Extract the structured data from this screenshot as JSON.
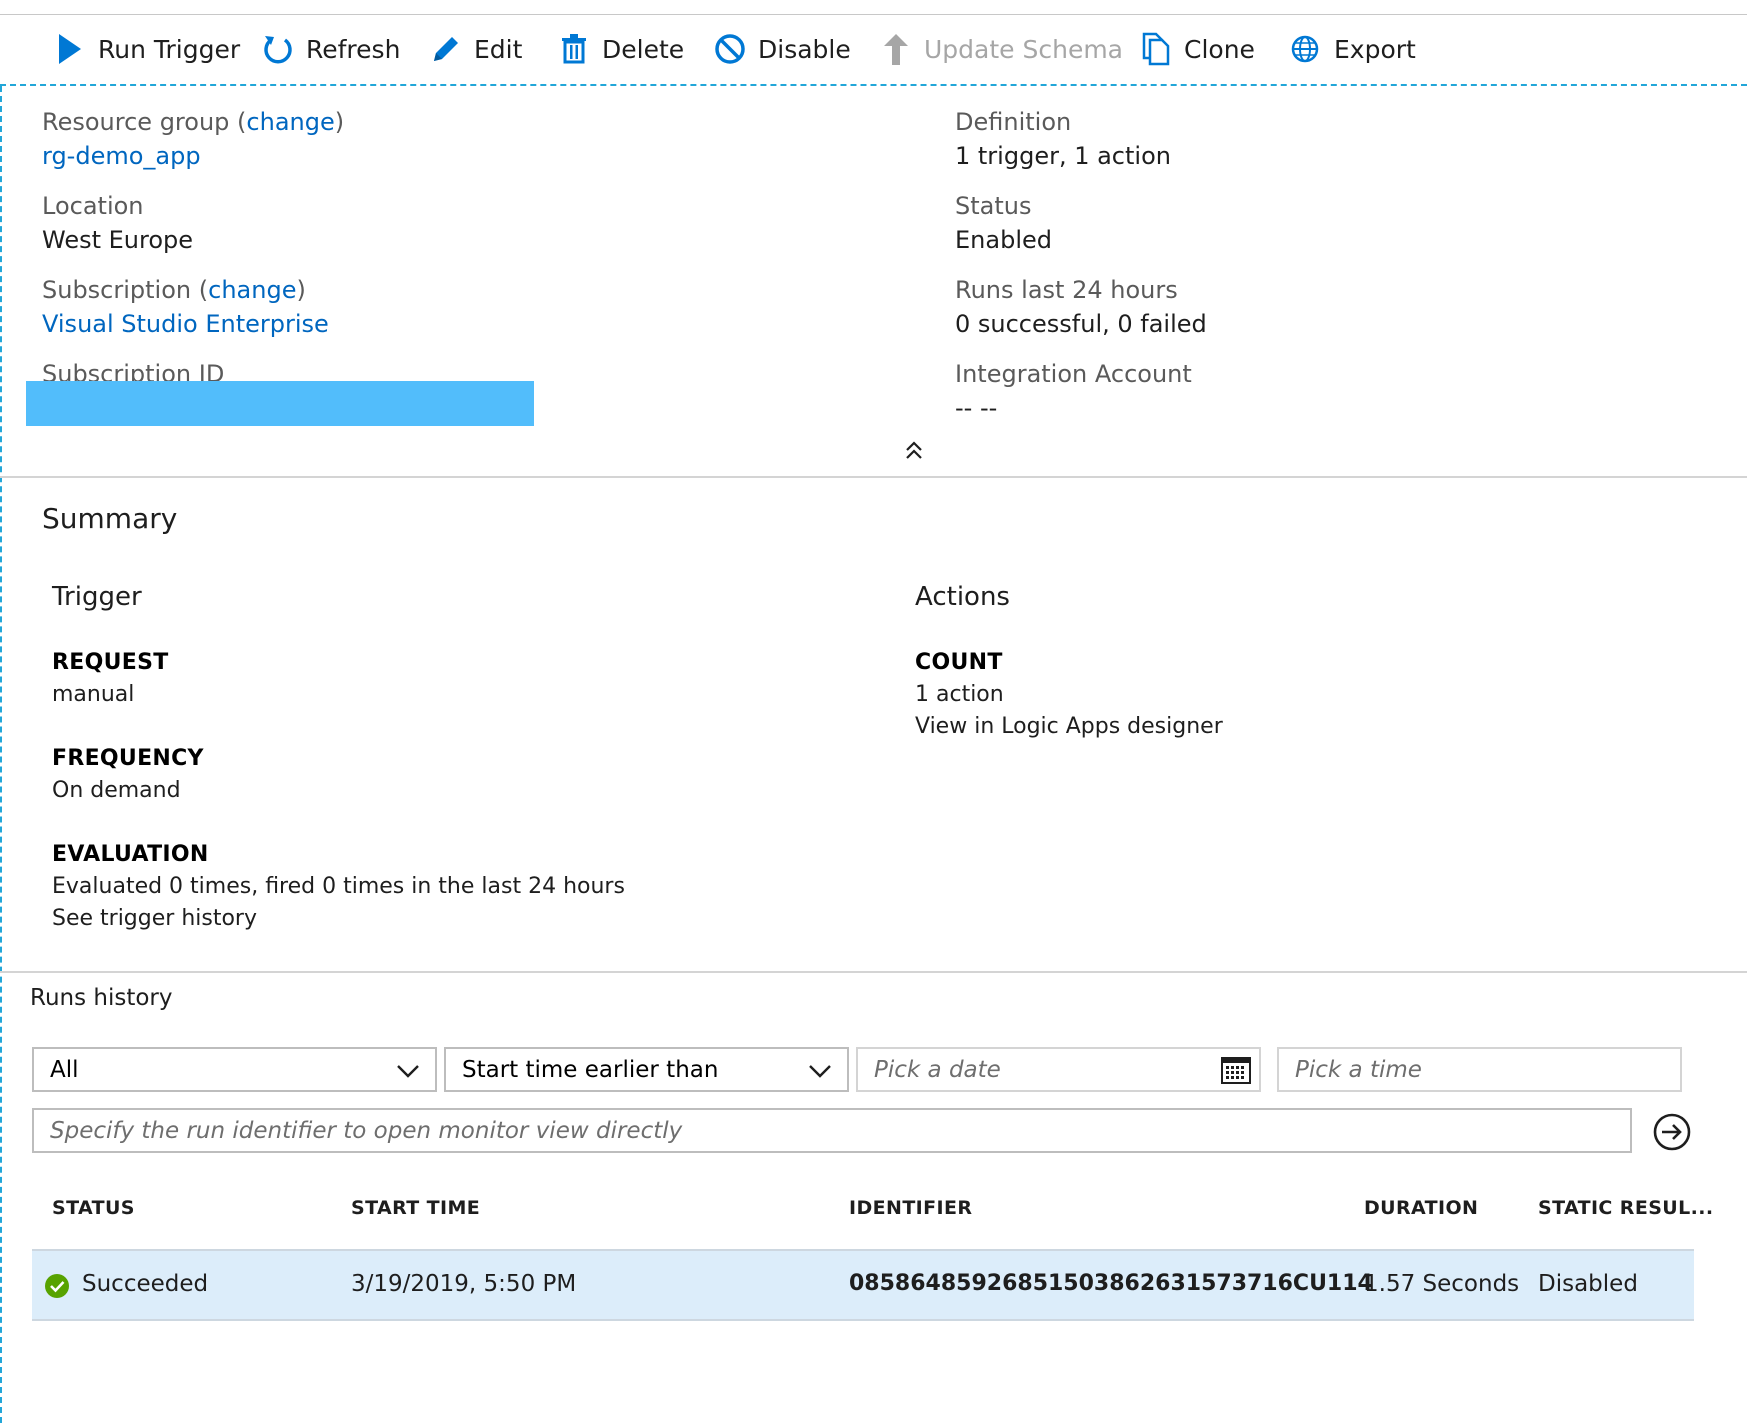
{
  "toolbar": {
    "run_trigger": "Run Trigger",
    "refresh": "Refresh",
    "edit": "Edit",
    "delete": "Delete",
    "disable": "Disable",
    "update_schema": "Update Schema",
    "clone": "Clone",
    "export": "Export"
  },
  "essentials": {
    "resource_group_label": "Resource group",
    "change_label": "change",
    "resource_group_value": "rg-demo_app",
    "location_label": "Location",
    "location_value": "West Europe",
    "subscription_label": "Subscription",
    "subscription_value": "Visual Studio Enterprise",
    "subscription_id_label": "Subscription ID",
    "definition_label": "Definition",
    "definition_value": "1 trigger, 1 action",
    "status_label": "Status",
    "status_value": "Enabled",
    "runs_label": "Runs last 24 hours",
    "runs_value": "0 successful, 0 failed",
    "integration_label": "Integration Account",
    "integration_value": "-- --"
  },
  "summary": {
    "title": "Summary",
    "trigger_heading": "Trigger",
    "request_key": "REQUEST",
    "request_value": "manual",
    "frequency_key": "FREQUENCY",
    "frequency_value": "On demand",
    "evaluation_key": "EVALUATION",
    "evaluation_value": "Evaluated 0 times, fired 0 times in the last 24 hours",
    "trigger_history_link": "See trigger history",
    "actions_heading": "Actions",
    "count_key": "COUNT",
    "count_value": "1 action",
    "designer_link": "View in Logic Apps designer"
  },
  "runs": {
    "title": "Runs history",
    "status_filter": "All",
    "time_filter": "Start time earlier than",
    "date_placeholder": "Pick a date",
    "time_placeholder": "Pick a time",
    "run_id_placeholder": "Specify the run identifier to open monitor view directly",
    "columns": [
      "STATUS",
      "START TIME",
      "IDENTIFIER",
      "DURATION",
      "STATIC RESUL..."
    ],
    "rows": [
      {
        "status": "Succeeded",
        "start_time": "3/19/2019, 5:50 PM",
        "identifier": "08586485926851503862631573716CU114",
        "duration": "1.57 Seconds",
        "static_results": "Disabled"
      }
    ]
  },
  "colors": {
    "accent": "#0078d4",
    "link": "#0066bf",
    "success": "#57a300",
    "dashed_border": "#22a6d8",
    "redaction": "#52bdfb",
    "selected_row": "#dcedfa"
  }
}
